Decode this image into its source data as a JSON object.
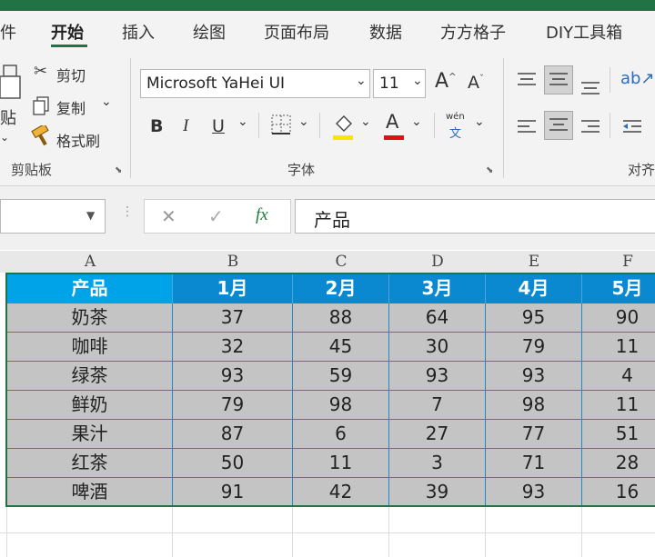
{
  "tabs": [
    "件",
    "开始",
    "插入",
    "绘图",
    "页面布局",
    "数据",
    "方方格子",
    "DIY工具箱"
  ],
  "clipboard": {
    "paste_label_left": "贴",
    "cut_label": "剪切",
    "copy_label": "复制",
    "format_painter_label": "格式刷",
    "group_label": "剪贴板"
  },
  "font": {
    "name": "Microsoft YaHei UI",
    "size": "11",
    "bold": "B",
    "italic": "I",
    "underline": "U",
    "grow": "A",
    "shrink": "A",
    "font_color": "A",
    "phonetic_top": "wén",
    "phonetic_bottom": "文",
    "group_label": "字体",
    "highlight_color": "#f5e800",
    "font_color_bar": "#e0101a"
  },
  "alignment": {
    "group_label": "对齐"
  },
  "formula_bar": {
    "fx": "fx",
    "content": "产品"
  },
  "columns": [
    "A",
    "B",
    "C",
    "D",
    "E",
    "F"
  ],
  "table": {
    "headers": [
      "产品",
      "1月",
      "2月",
      "3月",
      "4月",
      "5月"
    ],
    "rows": [
      [
        "奶茶",
        "37",
        "88",
        "64",
        "95",
        "90"
      ],
      [
        "咖啡",
        "32",
        "45",
        "30",
        "79",
        "11"
      ],
      [
        "绿茶",
        "93",
        "59",
        "93",
        "93",
        "4"
      ],
      [
        "鲜奶",
        "79",
        "98",
        "7",
        "98",
        "11"
      ],
      [
        "果汁",
        "87",
        "6",
        "27",
        "77",
        "51"
      ],
      [
        "红茶",
        "50",
        "11",
        "3",
        "71",
        "28"
      ],
      [
        "啤酒",
        "91",
        "42",
        "39",
        "93",
        "16"
      ]
    ]
  },
  "colors": {
    "header_bg": "#0a89d0",
    "first_header_bg": "#00a3e8",
    "cell_bg": "#c4c4c4",
    "border": "#1e88c8",
    "selection": "#217346"
  }
}
